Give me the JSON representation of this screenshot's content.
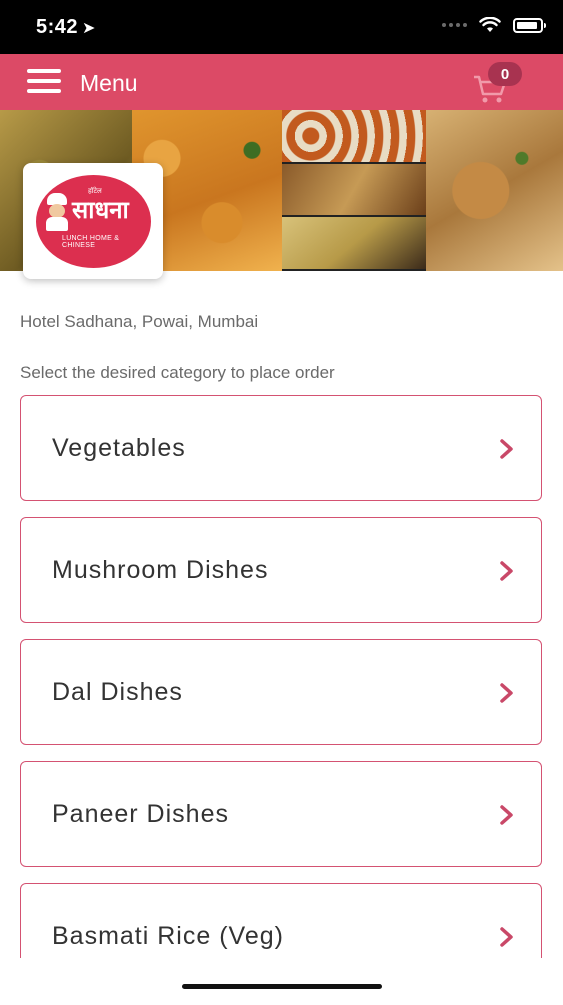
{
  "status_bar": {
    "time": "5:42",
    "location_icon": "location-arrow-icon",
    "signal_icon": "signal-icon",
    "wifi_icon": "wifi-icon",
    "battery_icon": "battery-icon"
  },
  "header": {
    "menu_icon": "hamburger-icon",
    "title": "Menu",
    "cart_icon": "cart-icon",
    "cart_count": "0",
    "background_color": "#dc4a66"
  },
  "restaurant": {
    "logo_text_small": "हॉटेल",
    "logo_text_main": "साधना",
    "logo_subtext": "LUNCH HOME & CHINESE",
    "location": "Hotel Sadhana, Powai, Mumbai"
  },
  "instruction": "Select the desired category to place order",
  "categories": [
    {
      "label": "Vegetables"
    },
    {
      "label": "Mushroom Dishes"
    },
    {
      "label": "Dal Dishes"
    },
    {
      "label": "Paneer Dishes"
    },
    {
      "label": "Basmati Rice (Veg)"
    }
  ],
  "colors": {
    "accent": "#dc4a66",
    "category_border": "#d45272",
    "chevron": "#c94868",
    "secondary_text": "#6a6a6a"
  }
}
